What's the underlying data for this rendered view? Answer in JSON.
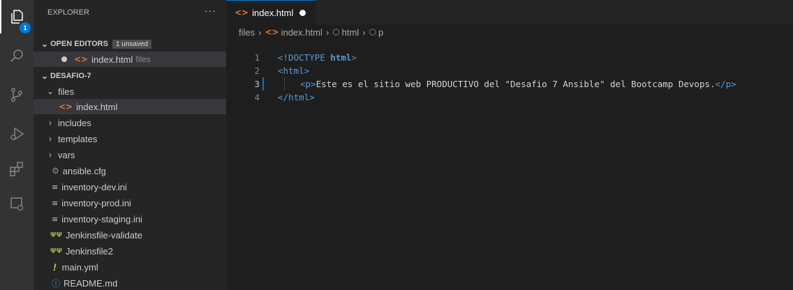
{
  "explorer": {
    "title": "EXPLORER",
    "more": "···",
    "open_editors": {
      "label": "OPEN EDITORS",
      "badge": "1 unsaved",
      "items": [
        {
          "name": "index.html",
          "folder": "files"
        }
      ]
    },
    "workspace": {
      "label": "DESAFIO-7",
      "tree": [
        {
          "label": "files",
          "type": "folder-open"
        },
        {
          "label": "index.html",
          "type": "html"
        },
        {
          "label": "includes",
          "type": "folder"
        },
        {
          "label": "templates",
          "type": "folder"
        },
        {
          "label": "vars",
          "type": "folder"
        },
        {
          "label": "ansible.cfg",
          "type": "config"
        },
        {
          "label": "inventory-dev.ini",
          "type": "ini"
        },
        {
          "label": "inventory-prod.ini",
          "type": "ini"
        },
        {
          "label": "inventory-staging.ini",
          "type": "ini"
        },
        {
          "label": "Jenkinsfile-validate",
          "type": "jenkins"
        },
        {
          "label": "Jenkinsfile2",
          "type": "jenkins"
        },
        {
          "label": "main.yml",
          "type": "yaml"
        },
        {
          "label": "README.md",
          "type": "info"
        }
      ]
    }
  },
  "activity_bar": {
    "badge": "1",
    "icons": [
      "files-icon",
      "search-icon",
      "source-control-icon",
      "run-debug-icon",
      "extensions-icon",
      "remote-explorer-icon"
    ]
  },
  "editor": {
    "tab": {
      "label": "index.html",
      "dirty": true
    },
    "breadcrumb": [
      "files",
      "index.html",
      "html",
      "p"
    ],
    "lines": [
      {
        "num": "1",
        "doctype": "<!DOCTYPE",
        "kw": "html",
        "close": ">"
      },
      {
        "num": "2",
        "open": "<html>"
      },
      {
        "num": "3",
        "p_open": "<p>",
        "text": "Este es el sitio web PRODUCTIVO del \"Desafio 7 Ansible\" del Bootcamp Devops.",
        "p_close": "</p>"
      },
      {
        "num": "4",
        "close_tag": "</html>"
      }
    ]
  },
  "colors": {
    "accent": "#0078d4",
    "html_icon": "#e37933",
    "jenkins_icon": "#8fb03d",
    "yaml_icon": "#e2c05a",
    "info_icon": "#4f9fe0"
  }
}
